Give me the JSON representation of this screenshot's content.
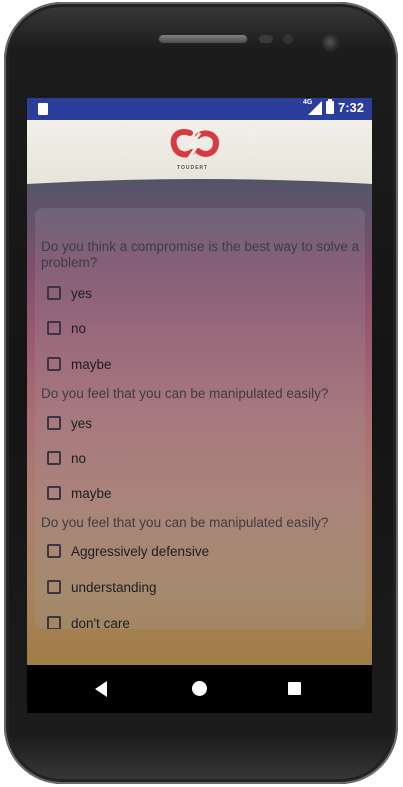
{
  "statusbar": {
    "network": "4G",
    "time": "7:32"
  },
  "header": {
    "logo_text": "TOUDERT"
  },
  "questions": [
    {
      "text": "Do you think a compromise is the best way to solve a problem?",
      "options": [
        "yes",
        "no",
        "maybe"
      ]
    },
    {
      "text": "Do you feel that you can be manipulated easily?",
      "options": [
        "yes",
        "no",
        "maybe"
      ]
    },
    {
      "text": "Do you feel that you can be manipulated easily?",
      "options": [
        "Aggressively defensive",
        "understanding",
        "don't care"
      ]
    }
  ],
  "colors": {
    "statusbar": "#2a3e9a",
    "logo_red": "#d83a44"
  }
}
